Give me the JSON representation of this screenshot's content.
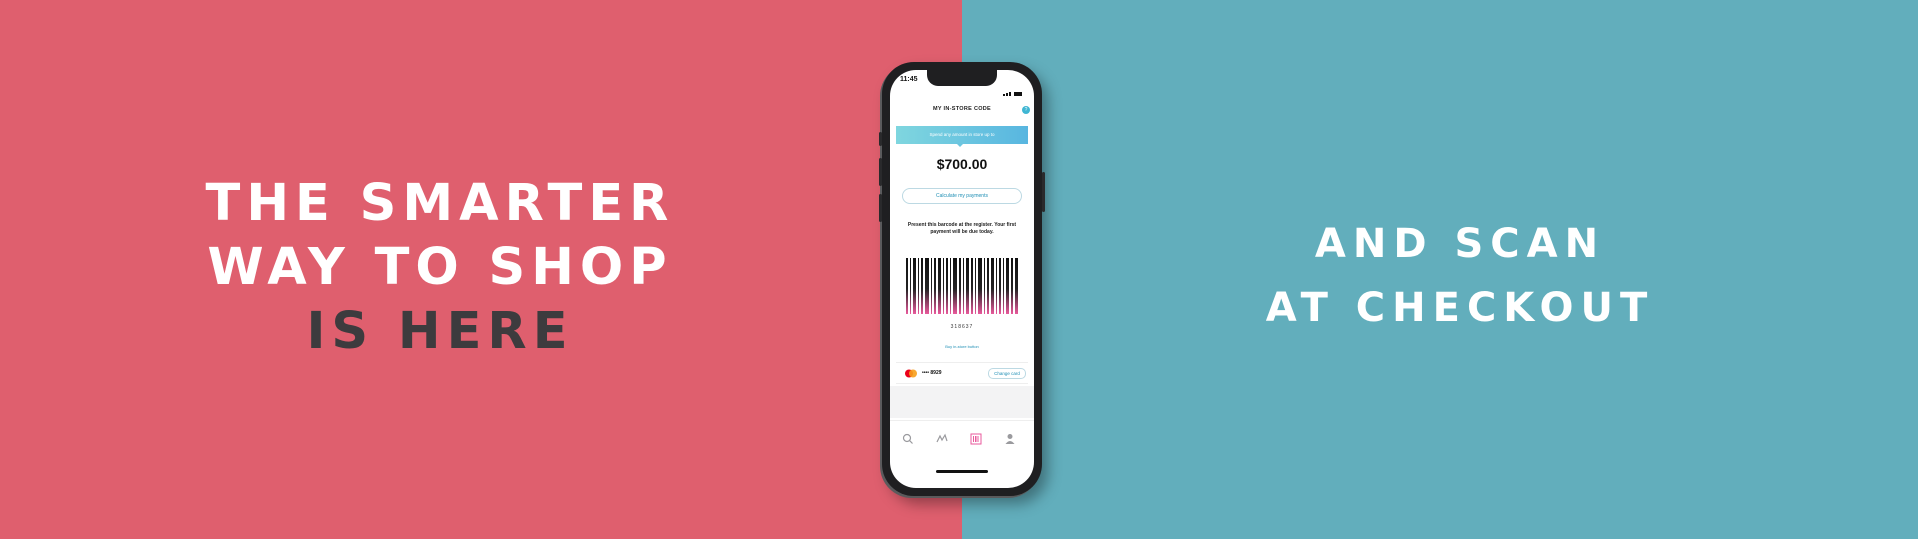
{
  "banner": {
    "left_lines": [
      {
        "text": "THE SMARTER"
      },
      {
        "text": "WAY TO SHOP"
      },
      {
        "text": "IS HERE"
      }
    ],
    "right_lines": [
      {
        "text": "AND SCAN"
      },
      {
        "text": "AT CHECKOUT"
      }
    ],
    "colors": {
      "left_bg": "#df5f6e",
      "right_bg": "#62aebc",
      "dark_text": "#3d3b3e"
    }
  },
  "phone": {
    "status_time": "11:45",
    "app_title": "MY IN-STORE CODE",
    "spend_label": "Spend any amount in store up to",
    "amount": "$700.00",
    "calc_button": "Calculate my payments",
    "instructions": "Present this barcode at the register. Your first payment will be due today.",
    "barcode_number": "318637",
    "link_text": "Buy in-store button",
    "card_number": "•••• 8929",
    "change_card_button": "Change card",
    "tabs": [
      {
        "icon": "search-icon"
      },
      {
        "icon": "shop-icon"
      },
      {
        "icon": "barcode-icon"
      },
      {
        "icon": "profile-icon"
      }
    ]
  }
}
